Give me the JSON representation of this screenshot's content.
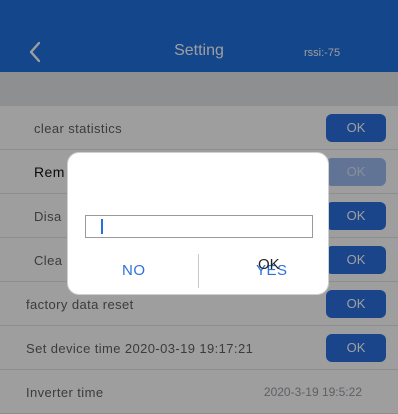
{
  "header": {
    "title": "Setting",
    "rssi": "rssi:-75",
    "back_icon": "chevron-left-icon",
    "color": "#1f72e0"
  },
  "rows": [
    {
      "label": "clear statistics",
      "button": "OK"
    },
    {
      "label": "Rem",
      "button": "OK"
    },
    {
      "label": "Disa",
      "button": "OK"
    },
    {
      "label": "Clea",
      "button": "OK"
    },
    {
      "label": "factory data reset",
      "button": "OK"
    },
    {
      "label": "Set device time 2020-03-19 19:17:21",
      "button": "OK"
    },
    {
      "label": "Inverter time",
      "value": "2020-3-19 19:5:22"
    }
  ],
  "dialog": {
    "input_value": "",
    "no_label": "NO",
    "yes_label": "YES",
    "ok_overlay": "OK"
  }
}
